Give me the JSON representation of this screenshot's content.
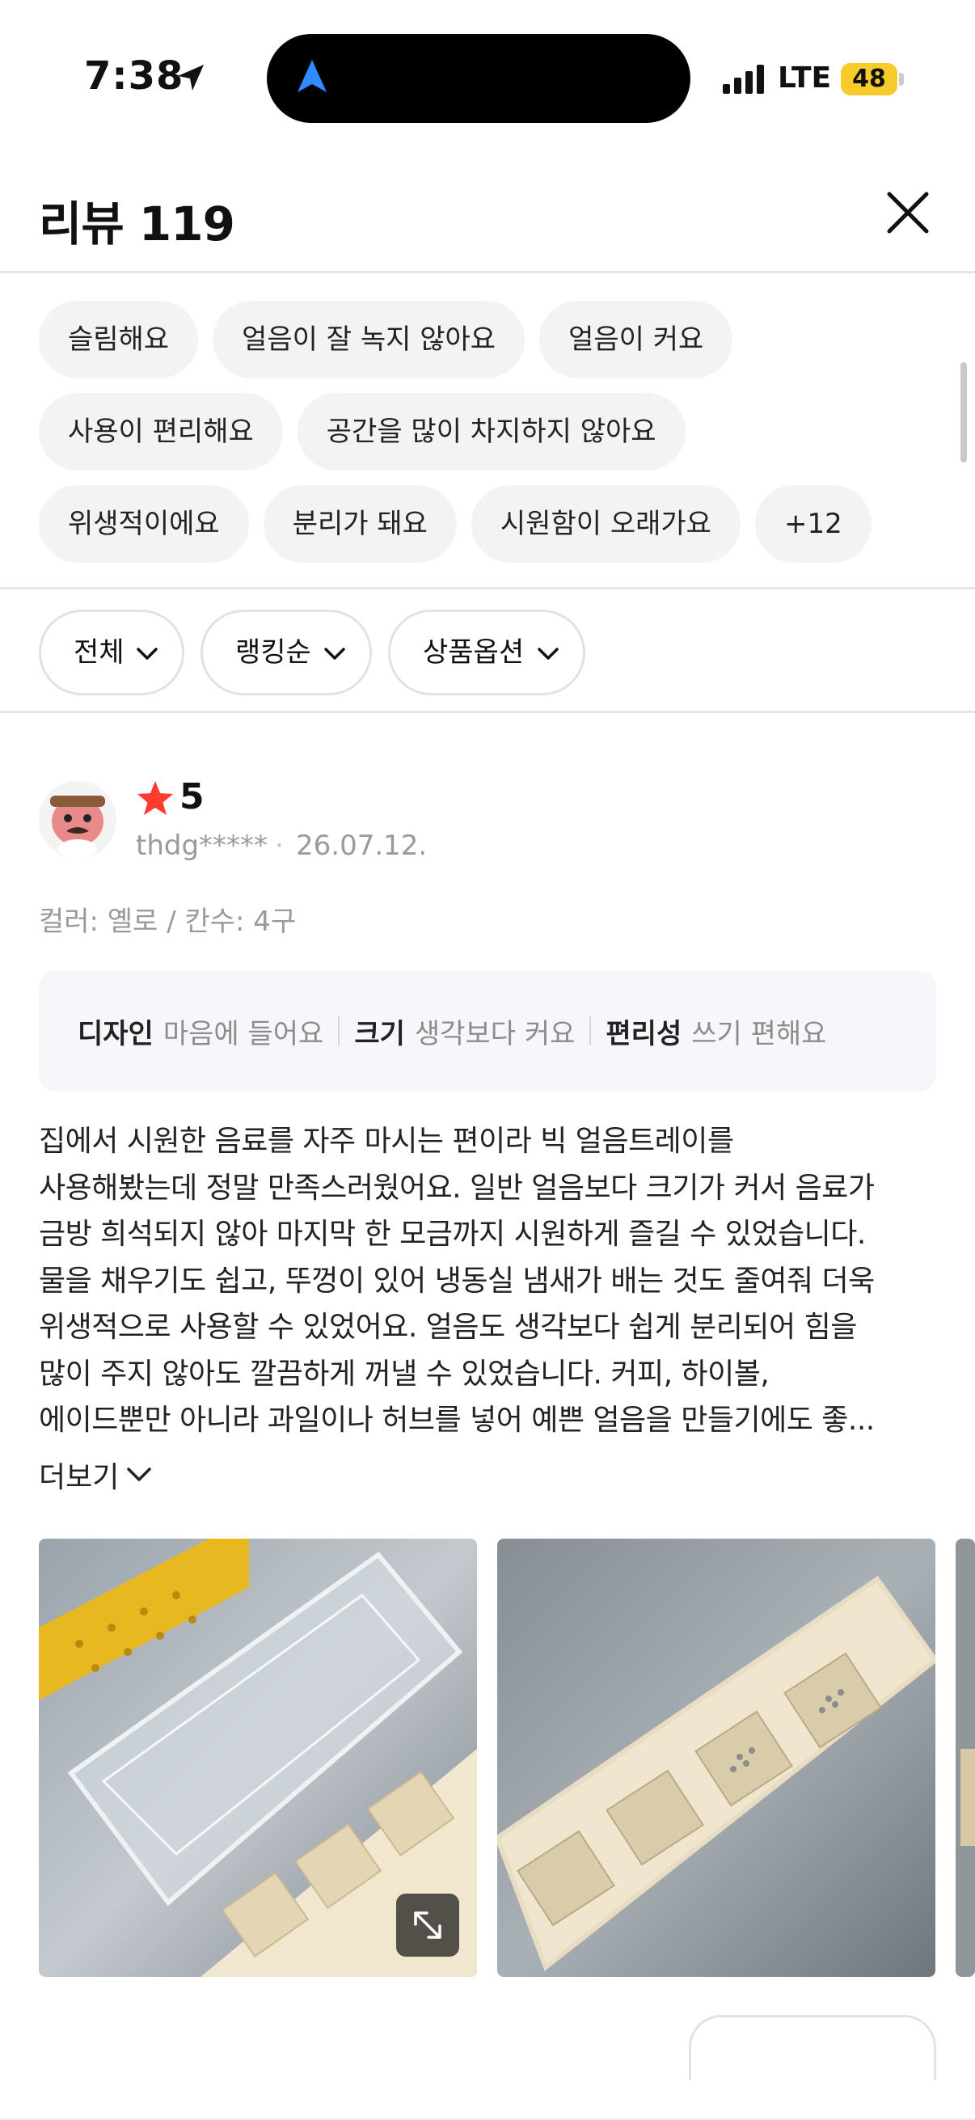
{
  "status_bar": {
    "time": "7:38",
    "network": "LTE",
    "battery": "48"
  },
  "header": {
    "title": "리뷰 119",
    "close_icon": "close-icon"
  },
  "tags": {
    "rows": [
      [
        "슬림해요",
        "얼음이 잘 녹지 않아요",
        "얼음이 커요"
      ],
      [
        "사용이 편리해요",
        "공간을 많이 차지하지 않아요"
      ],
      [
        "위생적이에요",
        "분리가 돼요",
        "시원함이 오래가요",
        "+12"
      ]
    ]
  },
  "filters": {
    "all": "전체",
    "ranking": "랭킹순",
    "option": "상품옵션"
  },
  "review": {
    "rating": "5",
    "author": "thdg*****",
    "separator": "·",
    "date": "26.07.12.",
    "option": "컬러: 옐로 / 칸수: 4구",
    "attributes": [
      {
        "key": "디자인",
        "value": "마음에 들어요"
      },
      {
        "key": "크기",
        "value": "생각보다 커요"
      },
      {
        "key": "편리성",
        "value": "쓰기 편해요"
      }
    ],
    "body_lines": [
      "집에서 시원한 음료를 자주 마시는 편이라 빅 얼음트레이를",
      "사용해봤는데 정말 만족스러웠어요. 일반 얼음보다 크기가 커서 음료가",
      "금방 희석되지 않아 마지막 한 모금까지 시원하게 즐길 수 있었습니다.",
      "물을 채우기도 쉽고, 뚜껑이 있어 냉동실 냄새가 배는 것도 줄여줘 더욱",
      "위생적으로 사용할 수 있었어요. 얼음도 생각보다 쉽게 분리되어 힘을",
      "많이 주지 않아도 깔끔하게 꺼낼 수 있었습니다. 커피, 하이볼,",
      "에이드뿐만 아니라 과일이나 허브를 넣어 예쁜 얼음을 만들기에도 좋..."
    ],
    "more_label": "더보기"
  },
  "colors": {
    "star": "#ff3b30",
    "tag_bg": "#f1f3f5",
    "battery": "#f7cc2a",
    "attr_bg": "#f5f7fa"
  }
}
